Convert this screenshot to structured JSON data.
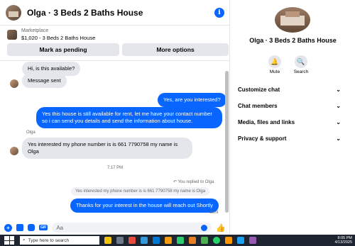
{
  "chat": {
    "title": "Olga · 3 Beds 2 Baths House",
    "marketplace_label": "Marketplace",
    "listing": "$1,020 - 3 Beds 2 Baths House",
    "btn_pending": "Mark as pending",
    "btn_options": "More options"
  },
  "messages": {
    "m1": "Hi, is this available?",
    "m2": "Message sent",
    "m3": "Yes, are you interested?",
    "m4": "Yes this house is still available for rent, let me have your contact number so i can send you details and send the information about house.",
    "sender": "Olga",
    "m5": "Yes interested my phone number is is 661 7790758 my name is Olga",
    "time": "7:17 PM",
    "replied": "You replied to Olga",
    "quote": "Yes interested my phone number is is 661 7790758 my name is Olga",
    "m6": "Thanks for your interest in the house will reach out Shortly",
    "status": "Sent"
  },
  "composer": {
    "placeholder": "Aa"
  },
  "panel": {
    "title": "Olga · 3 Beds 2 Baths House",
    "mute": "Mute",
    "search": "Search",
    "sections": [
      "Customize chat",
      "Chat members",
      "Media, files and links",
      "Privacy & support"
    ]
  },
  "taskbar": {
    "search": "Type here to search",
    "time": "8:05 PM",
    "date": "4/13/2025"
  }
}
